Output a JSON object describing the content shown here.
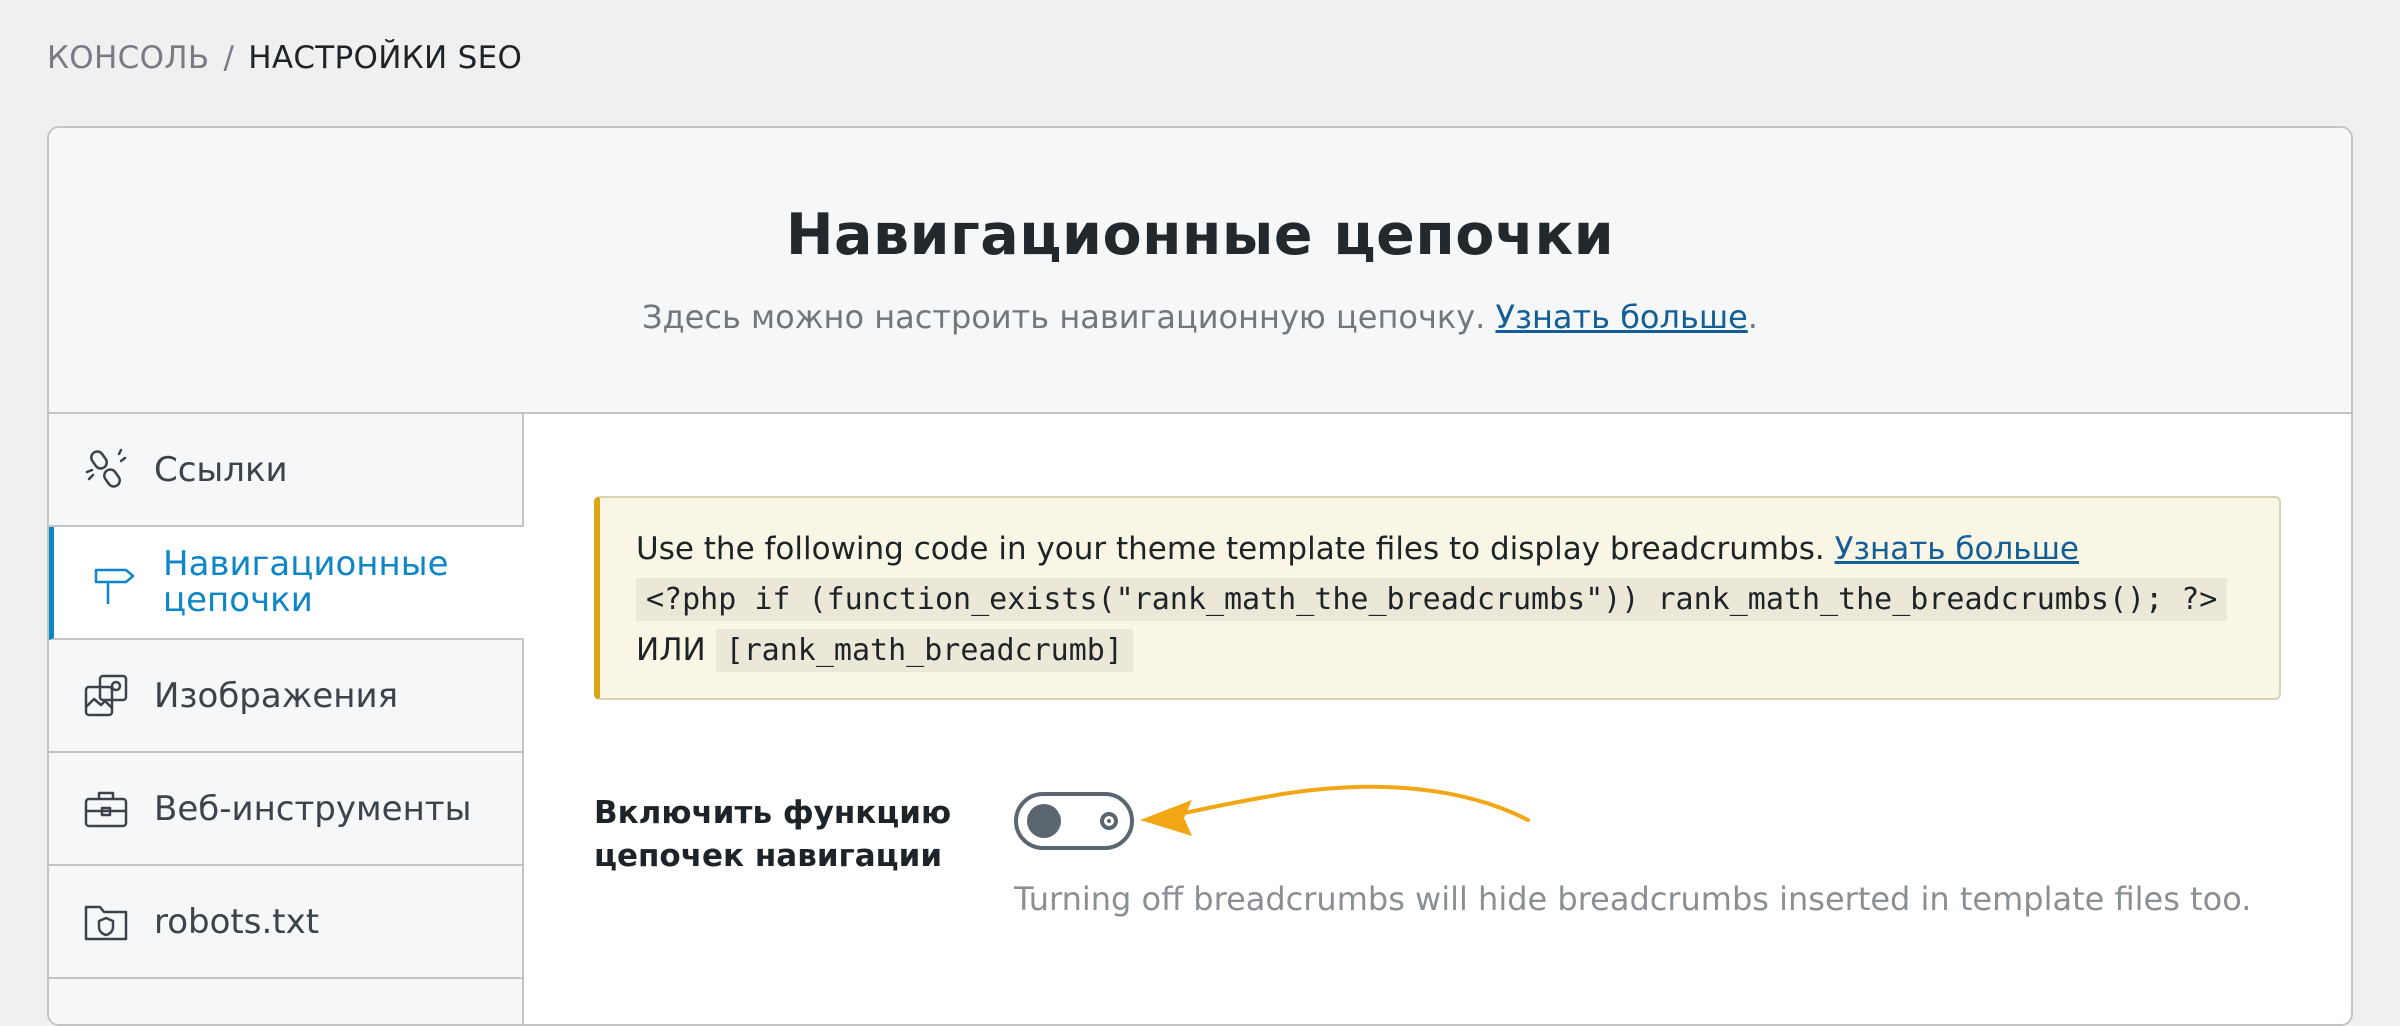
{
  "breadcrumb": {
    "parent": "КОНСОЛЬ",
    "separator": "/",
    "current": "НАСТРОЙКИ SEO"
  },
  "header": {
    "title": "Навигационные цепочки",
    "description": "Здесь можно настроить навигационную цепочку.",
    "learn_more": "Узнать больше",
    "period": "."
  },
  "sidebar": {
    "items": [
      {
        "label": "Ссылки",
        "icon": "links-icon"
      },
      {
        "label": "Навигационные цепочки",
        "icon": "signpost-icon",
        "active": true
      },
      {
        "label": "Изображения",
        "icon": "images-icon"
      },
      {
        "label": "Веб-инструменты",
        "icon": "toolbox-icon"
      },
      {
        "label": "robots.txt",
        "icon": "folder-shield-icon"
      }
    ]
  },
  "notice": {
    "text": "Use the following code in your theme template files to display breadcrumbs.",
    "learn_more": "Узнать больше",
    "code_php": "<?php if (function_exists(\"rank_math_the_breadcrumbs\")) rank_math_the_breadcrumbs(); ?>",
    "or": "ИЛИ",
    "code_shortcode": "[rank_math_breadcrumb]"
  },
  "setting": {
    "label_line1": "Включить функцию",
    "label_line2": "цепочек навигации",
    "toggle_state": "off",
    "help": "Turning off breadcrumbs will hide breadcrumbs inserted in template files too."
  },
  "colors": {
    "accent": "#0d86c8",
    "notice_border": "#dba617",
    "arrow": "#f3a614"
  }
}
